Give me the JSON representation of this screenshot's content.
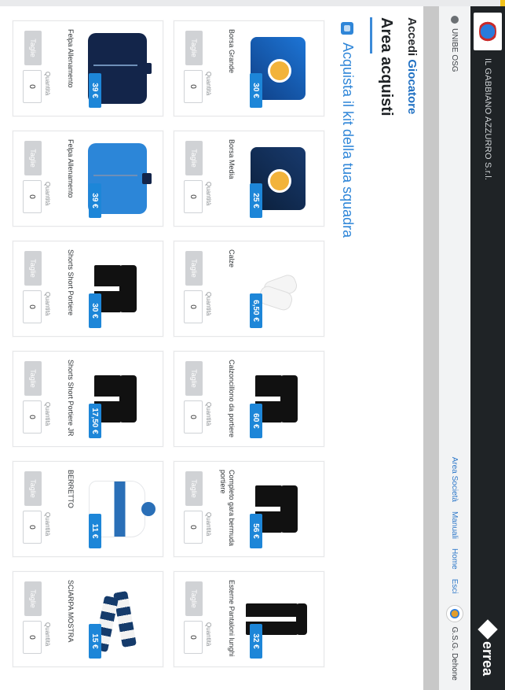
{
  "header": {
    "club_name": "IL GABBIANO AZZURRO S.r.l.",
    "brand": "errea"
  },
  "nav": {
    "user": "UNIBE OSG",
    "menu": [
      "Area Società",
      "Manuali",
      "Home",
      "Esci"
    ],
    "club_label": "G.S.G. Dehone"
  },
  "page": {
    "accedi": "Accedi",
    "accedi_role": "Giocatore",
    "area_title": "Area acquisti",
    "kit_title": "Acquista il kit della tua squadra"
  },
  "products": [
    {
      "name": "Borsa Grande",
      "price": "30 €",
      "qty_label": "Quantità",
      "qty": "0",
      "size_label": "Taglie"
    },
    {
      "name": "Borsa Media",
      "price": "25 €",
      "qty_label": "Quantità",
      "qty": "0",
      "size_label": "Taglie"
    },
    {
      "name": "Calze",
      "price": "6,50 €",
      "qty_label": "Quantità",
      "qty": "0",
      "size_label": "Taglie"
    },
    {
      "name": "Calzoncillono da portiere",
      "price": "60 €",
      "qty_label": "Quantità",
      "qty": "0",
      "size_label": "Taglie"
    },
    {
      "name": "Completo gara bermuda portiere",
      "price": "56 €",
      "qty_label": "Quantità",
      "qty": "0",
      "size_label": "Taglie"
    },
    {
      "name": "Esterne Pantaloni lunghi",
      "price": "32 €",
      "qty_label": "Quantità",
      "qty": "0",
      "size_label": "Taglie"
    },
    {
      "name": "Felpa Allenamento",
      "price": "39 €",
      "qty_label": "Quantità",
      "qty": "0",
      "size_label": "Taglie"
    },
    {
      "name": "Felpa Allenamento",
      "price": "39 €",
      "qty_label": "Quantità",
      "qty": "0",
      "size_label": "Taglie"
    },
    {
      "name": "Shorts Short Portiere",
      "price": "30 €",
      "qty_label": "Quantità",
      "qty": "0",
      "size_label": "Taglie"
    },
    {
      "name": "Shorts Short Portiere JR",
      "price": "17,50 €",
      "qty_label": "Quantità",
      "qty": "0",
      "size_label": "Taglie"
    },
    {
      "name": "BERRETTO",
      "price": "11 €",
      "qty_label": "Quantità",
      "qty": "0",
      "size_label": "Taglie"
    },
    {
      "name": "SCIARPA MOSTRA",
      "price": "15 €",
      "qty_label": "Quantità",
      "qty": "0",
      "size_label": "Taglie"
    }
  ]
}
